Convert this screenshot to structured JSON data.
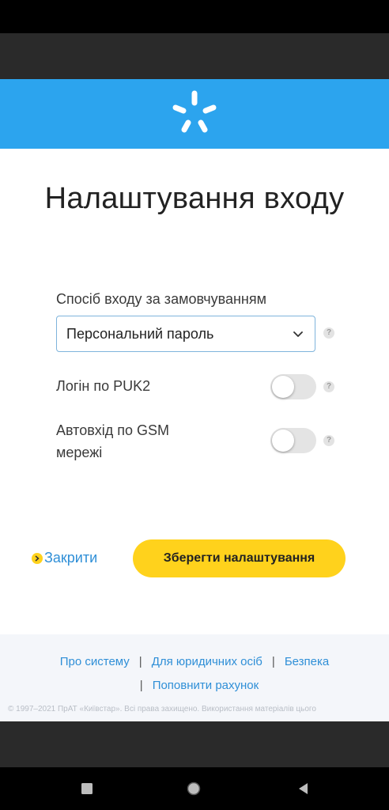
{
  "page": {
    "title": "Налаштування входу"
  },
  "login_method": {
    "label": "Спосіб входу за замовчуванням",
    "selected": "Персональний пароль",
    "help": "?"
  },
  "toggles": [
    {
      "label": "Логін по PUK2",
      "on": false,
      "help": "?"
    },
    {
      "label_line1": "Автовхід по GSM",
      "label_line2": "мережі",
      "on": false,
      "help": "?"
    }
  ],
  "actions": {
    "close_label": "Закрити",
    "save_label": "Зберегти налаштування"
  },
  "footer": {
    "links": [
      "Про систему",
      "Для юридичних осіб",
      "Безпека",
      "Поповнити рахунок"
    ],
    "separator": "|",
    "copyright": "© 1997–2021 ПрАТ «Київстар». Всі права захищено. Використання матеріалів цього"
  },
  "colors": {
    "brand_blue": "#2ca4ee",
    "accent_yellow": "#ffd21c",
    "link_blue": "#2f8fd7"
  },
  "icons": {
    "logo": "kyivstar-star-icon",
    "select_arrow": "chevron-down-icon",
    "close": "chevron-right-circle-icon",
    "nav": [
      "square-icon",
      "circle-icon",
      "back-triangle-icon"
    ]
  }
}
